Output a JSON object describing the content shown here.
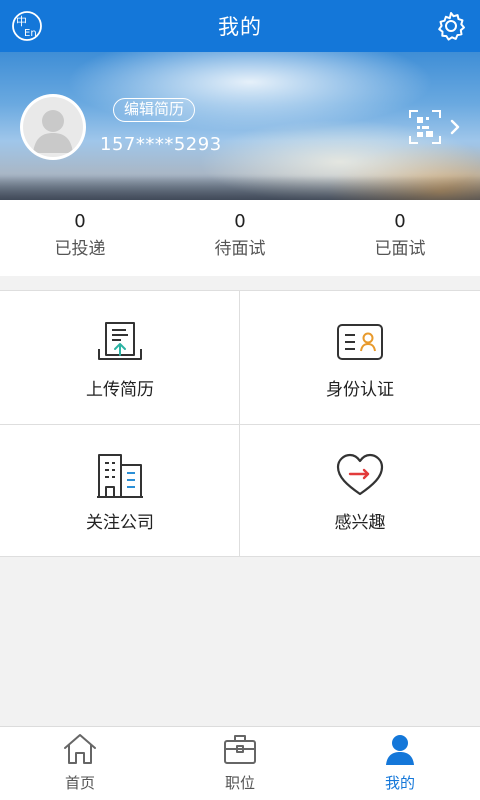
{
  "header": {
    "title": "我的",
    "lang_icon": "zh-en-language-icon",
    "settings_icon": "gear-icon",
    "accent": "#1477d9"
  },
  "profile": {
    "edit_resume_label": "编辑简历",
    "phone": "157****5293",
    "avatar_icon": "default-avatar-icon",
    "qr_icon": "qr-code-scan-icon"
  },
  "stats": [
    {
      "count": "0",
      "label": "已投递"
    },
    {
      "count": "0",
      "label": "待面试"
    },
    {
      "count": "0",
      "label": "已面试"
    }
  ],
  "menu": [
    {
      "label": "上传简历",
      "icon": "upload-resume-icon"
    },
    {
      "label": "身份认证",
      "icon": "id-card-icon"
    },
    {
      "label": "关注公司",
      "icon": "company-building-icon"
    },
    {
      "label": "感兴趣",
      "icon": "heart-icon"
    }
  ],
  "tabbar": [
    {
      "label": "首页",
      "icon": "home-icon",
      "active": false
    },
    {
      "label": "职位",
      "icon": "briefcase-icon",
      "active": false
    },
    {
      "label": "我的",
      "icon": "user-icon",
      "active": true
    }
  ]
}
